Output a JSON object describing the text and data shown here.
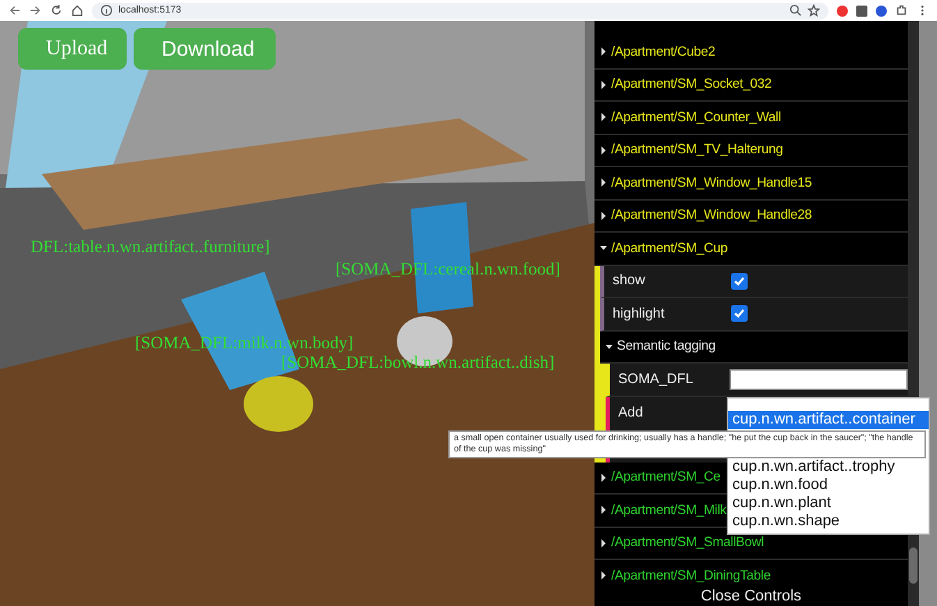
{
  "browser": {
    "url": "localhost:5173"
  },
  "toolbar": {
    "buttons": [
      {
        "label": "Upload",
        "kind": "serif"
      },
      {
        "label": "Download",
        "kind": "sans"
      }
    ]
  },
  "scene_labels": [
    {
      "text": "DFL:table.n.wn.artifact..furniture]"
    },
    {
      "text": "[SOMA_DFL:cereal.n.wn.food]"
    },
    {
      "text": "[SOMA_DFL:milk.n.wn.body]"
    },
    {
      "text": "[SOMA_DFL:bowl.n.wn.artifact..dish]"
    }
  ],
  "panel": {
    "items": [
      {
        "kind": "folder",
        "name": "/Apartment/Cube2",
        "color": "#e6e61a",
        "expanded": false
      },
      {
        "kind": "folder",
        "name": "/Apartment/SM_Socket_032",
        "color": "#e6e61a",
        "expanded": false
      },
      {
        "kind": "folder",
        "name": "/Apartment/SM_Counter_Wall",
        "color": "#e6e61a",
        "expanded": false
      },
      {
        "kind": "folder",
        "name": "/Apartment/SM_TV_Halterung",
        "color": "#e6e61a",
        "expanded": false
      },
      {
        "kind": "folder",
        "name": "/Apartment/SM_Window_Handle15",
        "color": "#e6e61a",
        "expanded": false
      },
      {
        "kind": "folder",
        "name": "/Apartment/SM_Window_Handle28",
        "color": "#e6e61a",
        "expanded": false
      },
      {
        "kind": "folder",
        "name": "/Apartment/SM_Cup",
        "color": "#e6e61a",
        "expanded": true,
        "children": [
          {
            "kind": "boolean",
            "name": "show",
            "checked": true
          },
          {
            "kind": "boolean",
            "name": "highlight",
            "checked": true
          },
          {
            "kind": "folder",
            "name": "Semantic tagging",
            "color": "#eeeeee",
            "expanded": true,
            "children": [
              {
                "kind": "text",
                "name": "SOMA_DFL"
              },
              {
                "kind": "function",
                "name": "Add"
              },
              {
                "kind": "function"
              }
            ]
          }
        ]
      },
      {
        "kind": "folder",
        "name": "/Apartment/SM_Ce",
        "color": "#2ed12e",
        "expanded": false
      },
      {
        "kind": "folder",
        "name": "/Apartment/SM_Milk",
        "color": "#2ed12e",
        "expanded": false
      },
      {
        "kind": "folder",
        "name": "/Apartment/SM_SmallBowl",
        "color": "#2ed12e",
        "expanded": false
      },
      {
        "kind": "folder",
        "name": "/Apartment/SM_DiningTable",
        "color": "#2ed12e",
        "expanded": false
      }
    ],
    "close_label": "Close Controls"
  },
  "suggestions": [
    {
      "label": "cup.n.wn.artifact..container",
      "selected": true
    },
    {
      "label": "cup.n.wn.artifact..trophy",
      "selected": false
    },
    {
      "label": "cup.n.wn.food",
      "selected": false
    },
    {
      "label": "cup.n.wn.plant",
      "selected": false
    },
    {
      "label": "cup.n.wn.shape",
      "selected": false
    }
  ],
  "tooltip": "a small open container usually used for drinking; usually has a handle; \"he put the cup back in the saucer\"; \"the handle of the cup was missing\""
}
